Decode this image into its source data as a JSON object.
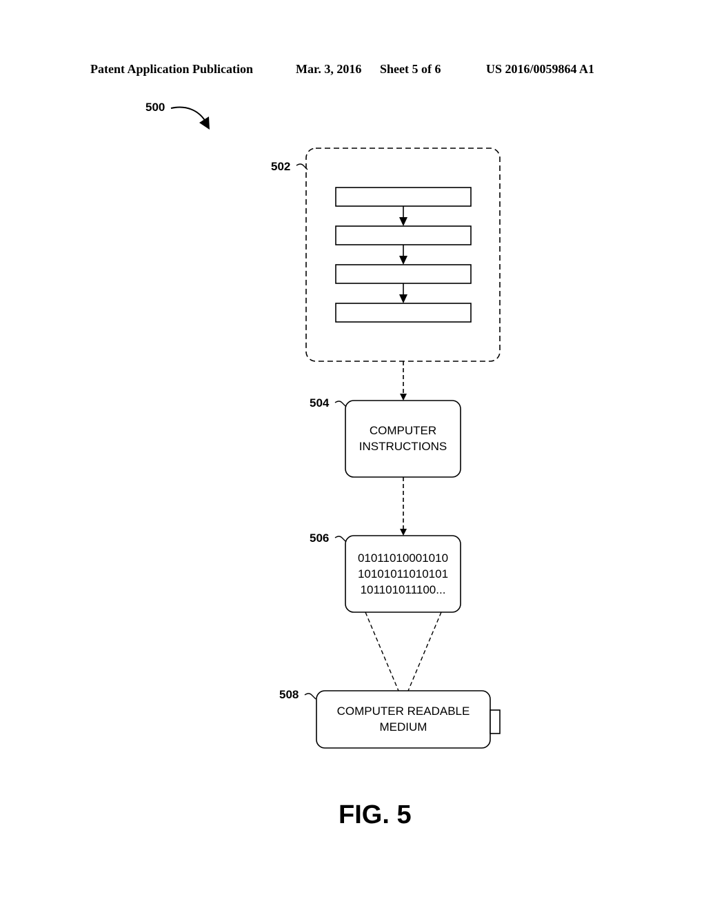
{
  "header": {
    "publication": "Patent Application Publication",
    "date": "Mar. 3, 2016",
    "sheet": "Sheet 5 of 6",
    "number": "US 2016/0059864 A1"
  },
  "figure": {
    "ref": "500",
    "caption": "FIG. 5",
    "nodes": [
      {
        "ref": "502",
        "type": "dashed-container",
        "steps": 4
      },
      {
        "ref": "504",
        "lines": [
          "COMPUTER",
          "INSTRUCTIONS"
        ]
      },
      {
        "ref": "506",
        "lines": [
          "01011010001010",
          "10101011010101",
          "101101011100..."
        ]
      },
      {
        "ref": "508",
        "lines": [
          "COMPUTER READABLE",
          "MEDIUM"
        ]
      }
    ]
  }
}
